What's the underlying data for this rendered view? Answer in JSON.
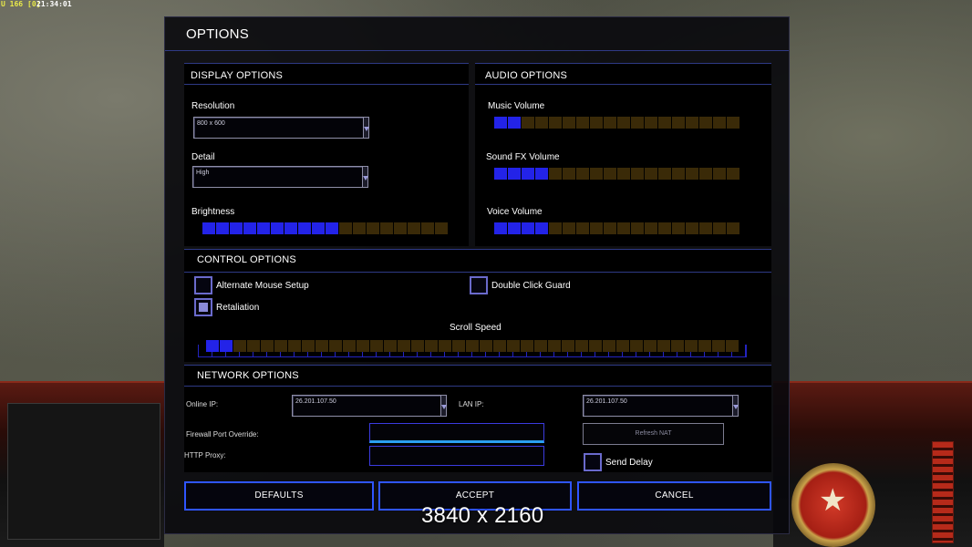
{
  "status_bar": {
    "label": "U 166",
    "count": "[0]",
    "time": "21:34:01"
  },
  "dialog": {
    "title": "OPTIONS",
    "display": {
      "header": "DISPLAY OPTIONS",
      "resolution_label": "Resolution",
      "resolution_value": "800 x 600",
      "detail_label": "Detail",
      "detail_value": "High",
      "brightness_label": "Brightness",
      "brightness_level": 10,
      "brightness_max": 18
    },
    "audio": {
      "header": "AUDIO OPTIONS",
      "music_label": "Music Volume",
      "music_level": 2,
      "sfx_label": "Sound FX Volume",
      "sfx_level": 4,
      "voice_label": "Voice Volume",
      "voice_level": 4,
      "max": 18
    },
    "control": {
      "header": "CONTROL OPTIONS",
      "alt_mouse_label": "Alternate Mouse Setup",
      "alt_mouse_checked": false,
      "retaliation_label": "Retaliation",
      "retaliation_checked": true,
      "double_click_label": "Double Click Guard",
      "double_click_checked": false,
      "scroll_label": "Scroll Speed",
      "scroll_level": 2,
      "scroll_max": 39
    },
    "network": {
      "header": "NETWORK OPTIONS",
      "online_ip_label": "Online IP:",
      "online_ip_value": "26.201.107.50",
      "lan_ip_label": "LAN IP:",
      "lan_ip_value": "26.201.107.50",
      "firewall_label": "Firewall Port Override:",
      "firewall_value": "",
      "proxy_label": "HTTP Proxy:",
      "proxy_value": "",
      "refresh_nat_label": "Refresh NAT",
      "send_delay_label": "Send Delay",
      "send_delay_checked": false
    },
    "buttons": {
      "defaults": "DEFAULTS",
      "accept": "ACCEPT",
      "cancel": "CANCEL"
    }
  },
  "overlay_text": "3840 x 2160",
  "colors": {
    "accent": "#2f55ff",
    "slider_on": "#2323e8",
    "slider_off": "#3a2a08"
  }
}
